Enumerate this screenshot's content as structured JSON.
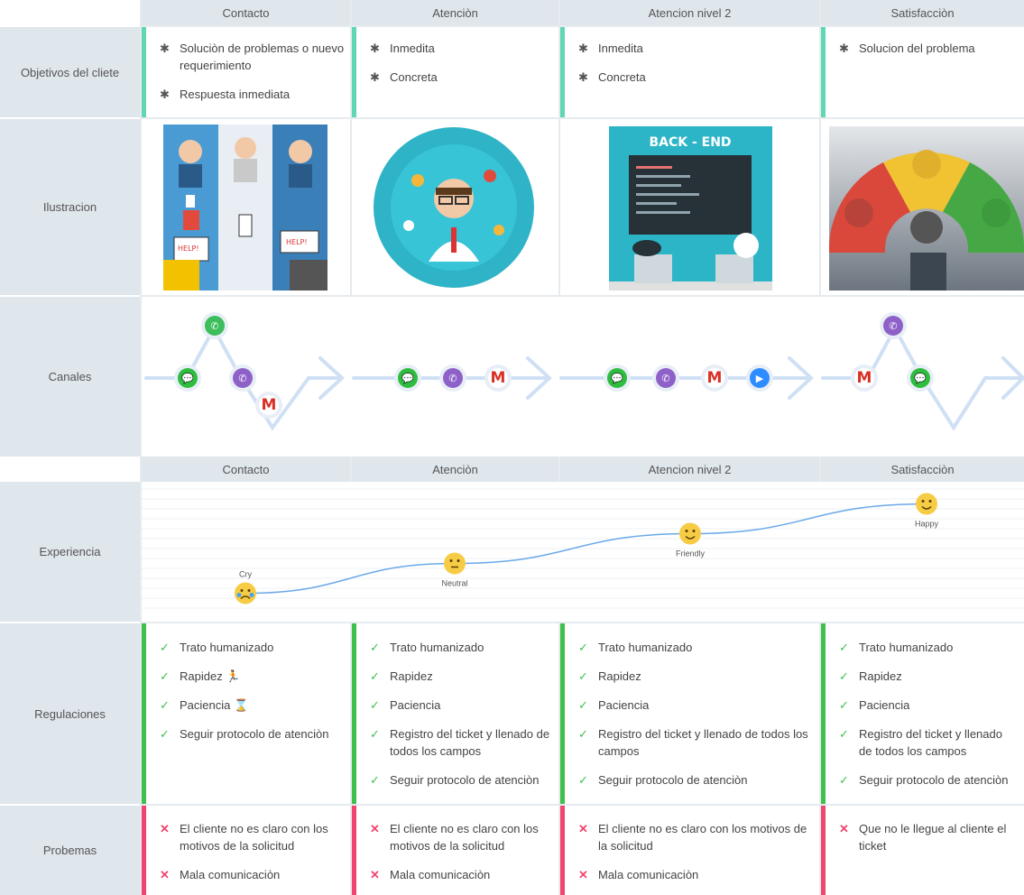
{
  "stages": [
    "Contacto",
    "Atenciòn",
    "Atencion nivel 2",
    "Satisfacciòn"
  ],
  "rows": {
    "objetivos": "Objetivos del cliete",
    "ilustracion": "Ilustracion",
    "canales": "Canales",
    "experiencia": "Experiencia",
    "regulaciones": "Regulaciones",
    "problemas": "Probemas"
  },
  "objetivos": [
    [
      "Soluciòn de problemas o nuevo requerimiento",
      "Respuesta inmediata"
    ],
    [
      "Inmedita",
      "Concreta"
    ],
    [
      "Inmedita",
      "Concreta"
    ],
    [
      "Solucion del problema"
    ]
  ],
  "illustration_text": {
    "backend": "BACK - END",
    "help": "HELP!"
  },
  "channels": [
    [
      "wechat",
      "whatsapp",
      "viber",
      "gmail"
    ],
    [
      "wechat",
      "viber",
      "gmail"
    ],
    [
      "wechat",
      "viber",
      "gmail",
      "zoom"
    ],
    [
      "gmail",
      "viber",
      "wechat"
    ]
  ],
  "chart_data": {
    "type": "line",
    "categories": [
      "Contacto",
      "Atenciòn",
      "Atencion nivel 2",
      "Satisfacciòn"
    ],
    "series": [
      {
        "values": [
          1,
          2,
          3,
          4
        ]
      }
    ],
    "point_labels": [
      "Cry",
      "Neutral",
      "Friendly",
      "Happy"
    ],
    "ylim": [
      0.5,
      4.5
    ],
    "grid": true
  },
  "regulaciones": [
    [
      "Trato humanizado",
      "Rapidez",
      "Paciencia",
      "Seguir protocolo de atenciòn"
    ],
    [
      "Trato humanizado",
      "Rapidez",
      "Paciencia",
      "Registro del ticket y llenado de todos los campos",
      "Seguir protocolo de atenciòn"
    ],
    [
      "Trato humanizado",
      "Rapidez",
      "Paciencia",
      "Registro del ticket y llenado de todos los campos",
      "Seguir protocolo de atenciòn"
    ],
    [
      "Trato humanizado",
      "Rapidez",
      "Paciencia",
      "Registro del ticket y llenado de todos los campos",
      "Seguir protocolo de atenciòn"
    ]
  ],
  "regulaciones_emoji": {
    "rapidez": "🏃",
    "paciencia": "⌛"
  },
  "problemas": [
    [
      "El cliente no es claro con los motivos de la solicitud",
      "Mala comunicaciòn"
    ],
    [
      "El cliente no es claro con los motivos de la solicitud",
      "Mala comunicaciòn"
    ],
    [
      "El cliente no es claro con los motivos de la solicitud",
      "Mala comunicaciòn"
    ],
    [
      "Que no le llegue al cliente el ticket"
    ]
  ],
  "colors": {
    "teal": "#5fd7b4",
    "green": "#3fc04c",
    "red": "#f0456e",
    "header": "#dfe6ec",
    "line": "#6aa9e8",
    "emoji": "#f7cc45"
  }
}
